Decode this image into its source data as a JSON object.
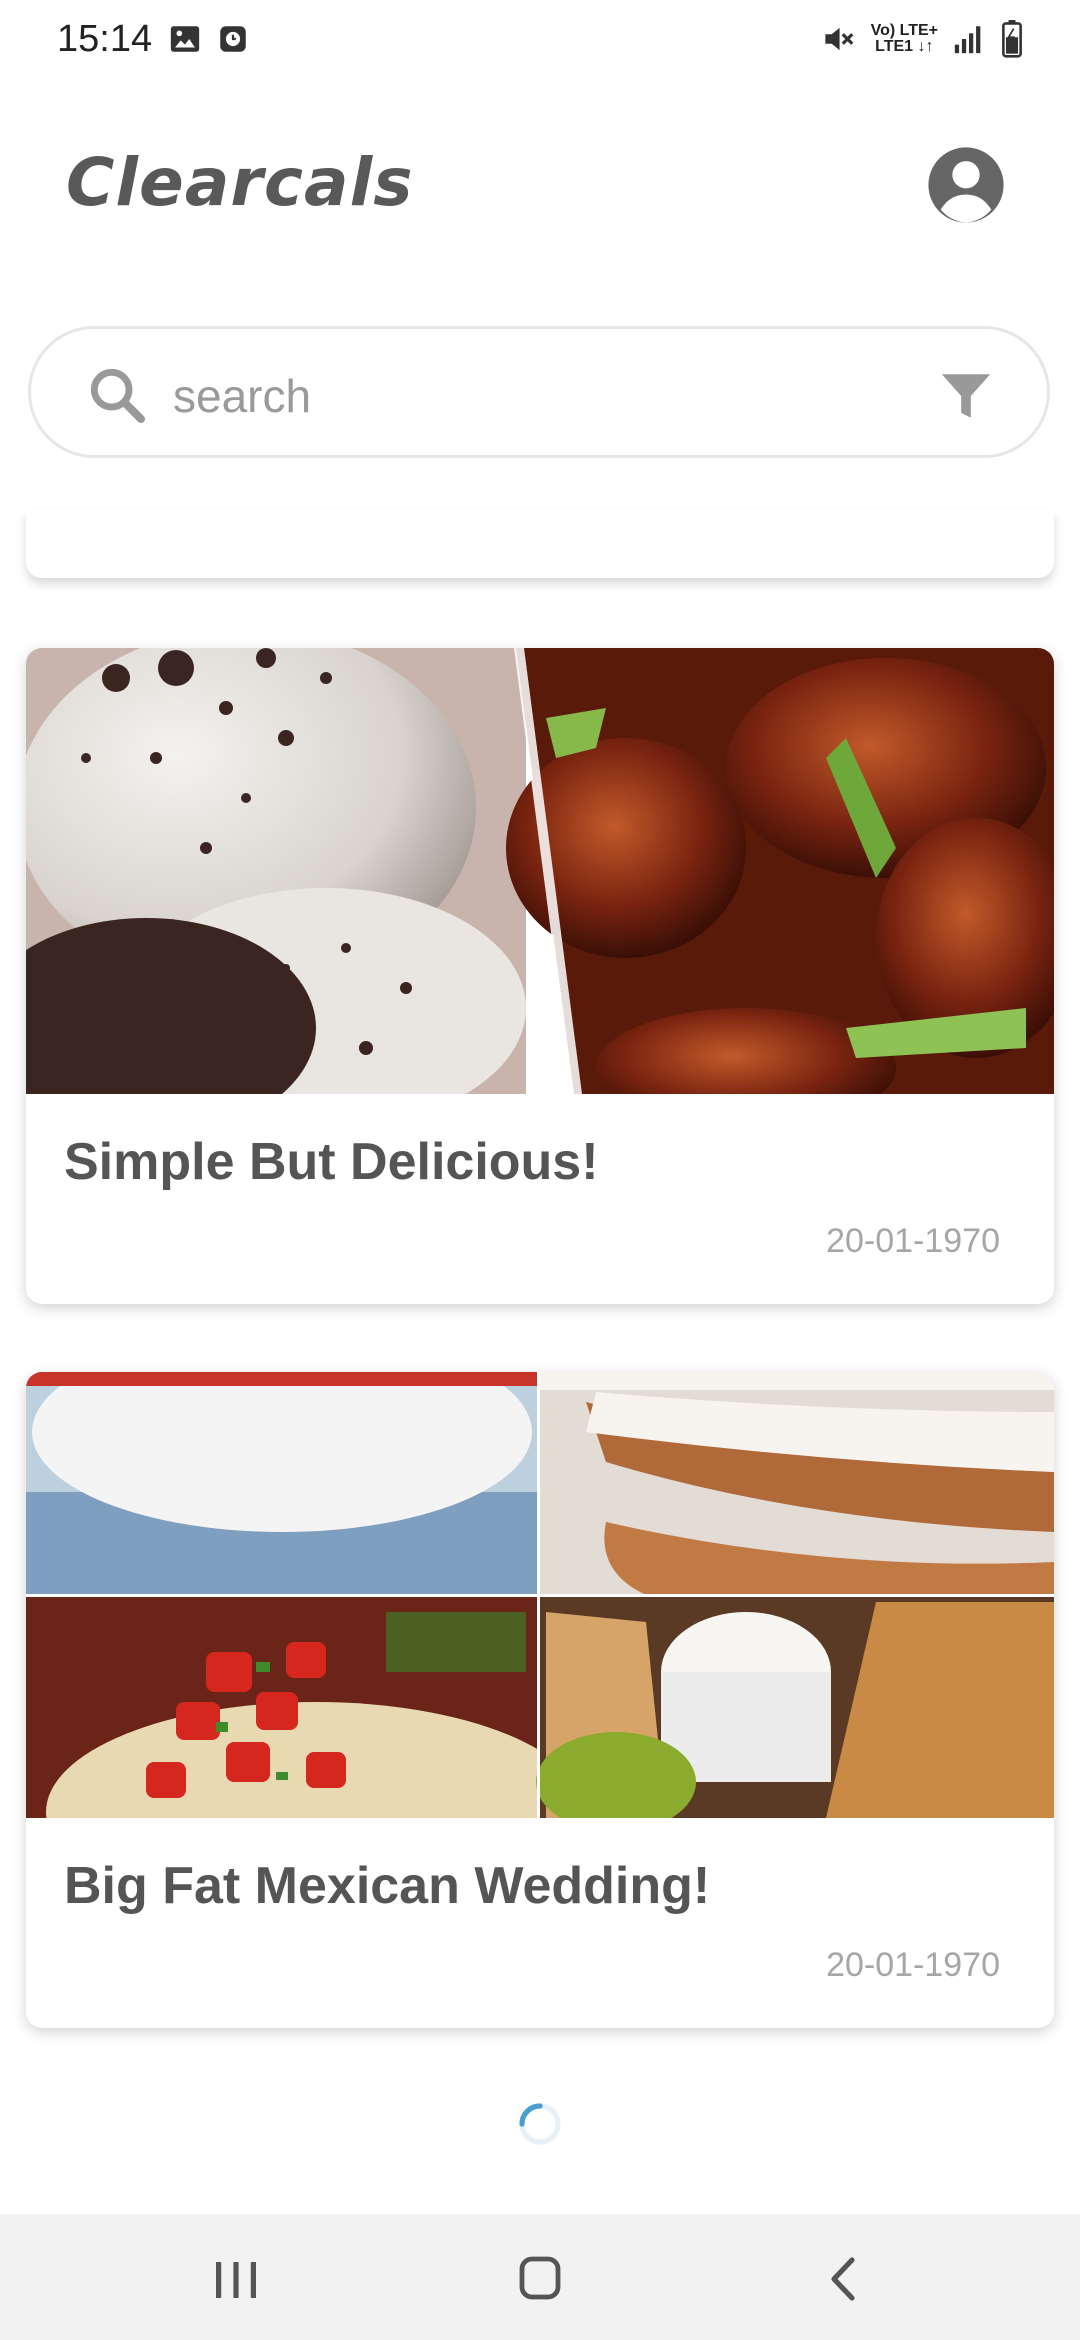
{
  "status_bar": {
    "time": "15:14",
    "lte_top": "Vo) LTE+",
    "lte_bottom": "LTE1 ↓↑",
    "icons": [
      "image-icon",
      "alarm-icon",
      "mute-icon",
      "signal-icon",
      "battery-icon"
    ]
  },
  "app": {
    "title": "Clearcals",
    "account_icon": "account-circle-icon"
  },
  "search": {
    "placeholder": "search",
    "value": "",
    "left_icon": "search-icon",
    "right_icon": "filter-icon"
  },
  "cards": [
    {
      "title": "Simple But Delicious!",
      "date": "20-01-1970",
      "images": [
        "cookies-and-cream-ice-cream",
        "glazed-meatballs-with-scallions"
      ]
    },
    {
      "title": "Big Fat Mexican Wedding!",
      "date": "20-01-1970",
      "images": [
        "pico-de-gallo-bowl",
        "layered-cake-with-cream",
        "burrito-with-salsa",
        "quesadilla-with-sour-cream-and-guacamole"
      ]
    }
  ],
  "loading": {
    "icon": "loading-spinner"
  },
  "nav": {
    "buttons": [
      "recent-apps-button",
      "home-button",
      "back-button"
    ]
  },
  "colors": {
    "title_gray": "#595959",
    "card_text": "#555555",
    "date_gray": "#a6a6a6",
    "navbar_bg": "#f2f2f2",
    "spinner": "#4a9fd0"
  }
}
